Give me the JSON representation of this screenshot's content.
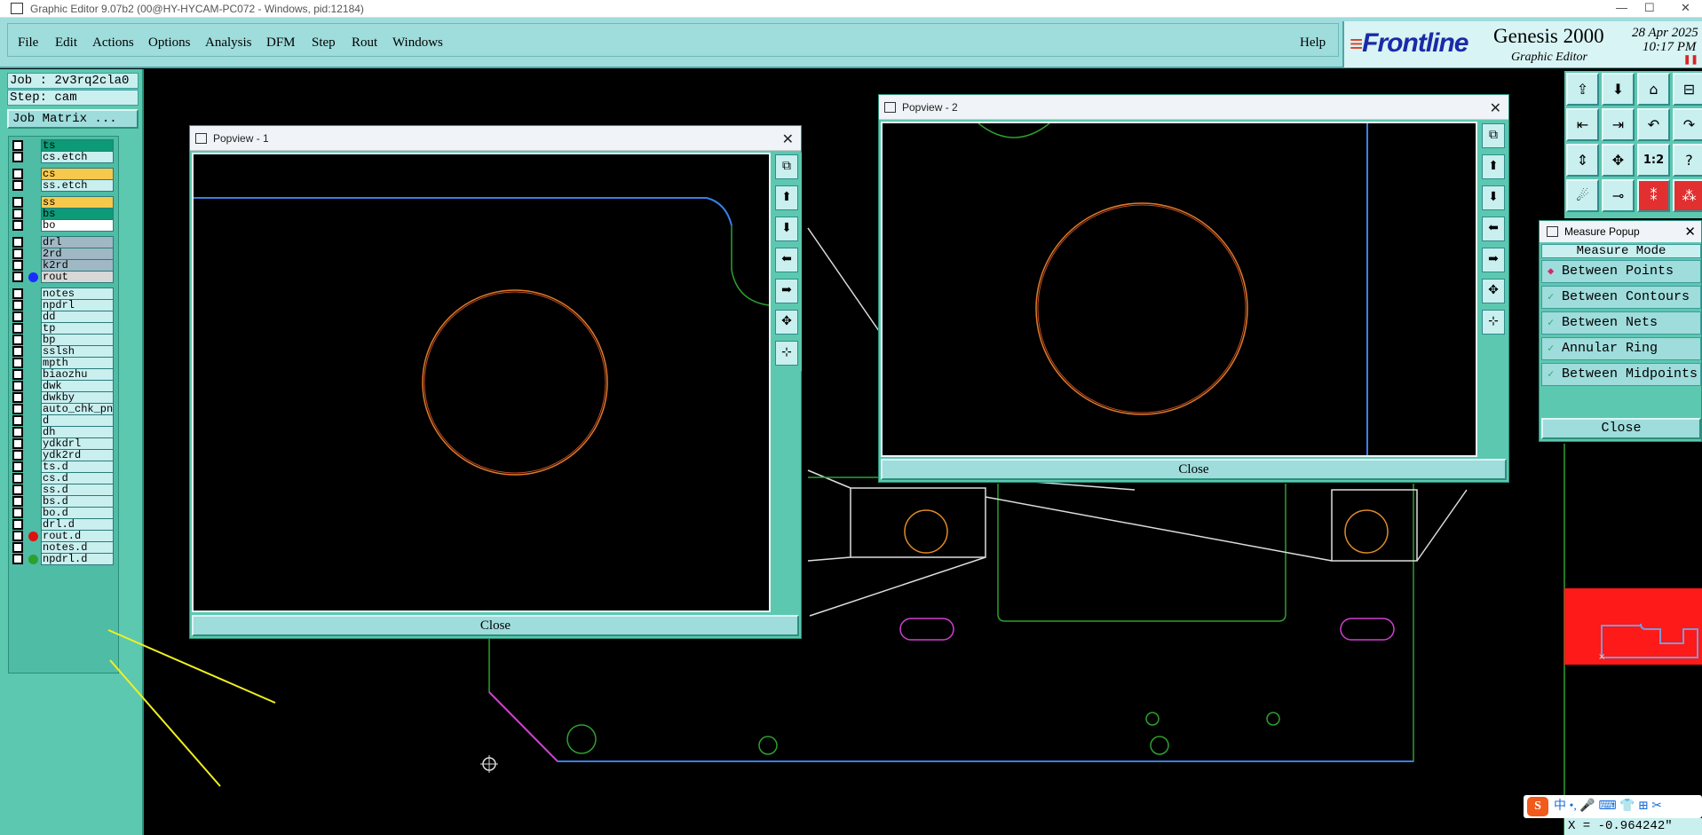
{
  "window": {
    "title": "Graphic Editor 9.07b2 (00@HY-HYCAM-PC072 - Windows, pid:12184)",
    "minimize": "—",
    "maximize": "☐",
    "close": "✕"
  },
  "menu": {
    "items": [
      "File",
      "Edit",
      "Actions",
      "Options",
      "Analysis",
      "DFM",
      "Step",
      "Rout",
      "Windows"
    ],
    "help": "Help"
  },
  "brand": {
    "logo": "Frontline",
    "product": "Genesis 2000",
    "subtitle": "Graphic Editor",
    "date": "28 Apr 2025",
    "time": "10:17 PM"
  },
  "left": {
    "job": "Job : 2v3rq2cla0",
    "step": "Step: cam",
    "job_matrix": "Job Matrix ..."
  },
  "layers": [
    {
      "name": "ts",
      "color": "#0d9a77",
      "dot": ""
    },
    {
      "name": "cs.etch",
      "color": "#c9efef",
      "dot": ""
    },
    {
      "name": "cs",
      "color": "#f6c94d",
      "dot": ""
    },
    {
      "name": "ss.etch",
      "color": "#c9efef",
      "dot": ""
    },
    {
      "name": "ss",
      "color": "#f6c94d",
      "dot": ""
    },
    {
      "name": "bs",
      "color": "#0d9a77",
      "dot": ""
    },
    {
      "name": "bo",
      "color": "#ffffff",
      "dot": ""
    },
    {
      "name": "drl",
      "color": "#9fb8c4",
      "dot": ""
    },
    {
      "name": "2rd",
      "color": "#9fb8c4",
      "dot": ""
    },
    {
      "name": "k2rd",
      "color": "#9fb8c4",
      "dot": ""
    },
    {
      "name": "rout",
      "color": "#d8d8d8",
      "dot": "#1a2cff"
    },
    {
      "name": "notes",
      "color": "#c9efef",
      "dot": ""
    },
    {
      "name": "npdrl",
      "color": "#c9efef",
      "dot": ""
    },
    {
      "name": "dd",
      "color": "#c9efef",
      "dot": ""
    },
    {
      "name": "tp",
      "color": "#c9efef",
      "dot": ""
    },
    {
      "name": "bp",
      "color": "#c9efef",
      "dot": ""
    },
    {
      "name": "sslsh",
      "color": "#c9efef",
      "dot": ""
    },
    {
      "name": "mpth",
      "color": "#c9efef",
      "dot": ""
    },
    {
      "name": "biaozhu",
      "color": "#c9efef",
      "dot": ""
    },
    {
      "name": "dwk",
      "color": "#c9efef",
      "dot": ""
    },
    {
      "name": "dwkby",
      "color": "#c9efef",
      "dot": ""
    },
    {
      "name": "auto_chk_pn",
      "color": "#c9efef",
      "dot": ""
    },
    {
      "name": "d",
      "color": "#c9efef",
      "dot": ""
    },
    {
      "name": "dh",
      "color": "#c9efef",
      "dot": ""
    },
    {
      "name": "ydkdrl",
      "color": "#c9efef",
      "dot": ""
    },
    {
      "name": "ydk2rd",
      "color": "#c9efef",
      "dot": ""
    },
    {
      "name": "ts.d",
      "color": "#c9efef",
      "dot": ""
    },
    {
      "name": "cs.d",
      "color": "#c9efef",
      "dot": ""
    },
    {
      "name": "ss.d",
      "color": "#c9efef",
      "dot": ""
    },
    {
      "name": "bs.d",
      "color": "#c9efef",
      "dot": ""
    },
    {
      "name": "bo.d",
      "color": "#c9efef",
      "dot": ""
    },
    {
      "name": "drl.d",
      "color": "#c9efef",
      "dot": ""
    },
    {
      "name": "rout.d",
      "color": "#c9efef",
      "dot": "#e01010"
    },
    {
      "name": "notes.d",
      "color": "#c9efef",
      "dot": ""
    },
    {
      "name": "npdrl.d",
      "color": "#c9efef",
      "dot": "#2ea02e"
    }
  ],
  "popview1": {
    "title": "Popview - 1",
    "close": "Close"
  },
  "popview2": {
    "title": "Popview - 2",
    "close": "Close"
  },
  "measure": {
    "title": "Measure Popup",
    "mode_header": "Measure Mode",
    "options": [
      "Between Points",
      "Between Contours",
      "Between Nets",
      "Annular Ring",
      "Between Midpoints"
    ],
    "selected": "Between Points",
    "close": "Close"
  },
  "status": {
    "coord": "X = -0.964242\""
  },
  "ime": {
    "label": "中 •, 🎤 ⌨ 👕 ⊞ ✂"
  },
  "colors": {
    "teal_panel": "#5cc8b0",
    "menu_bg": "#9fdcdc",
    "canvas": "#000000",
    "rout_red": "#ff1a1a"
  }
}
